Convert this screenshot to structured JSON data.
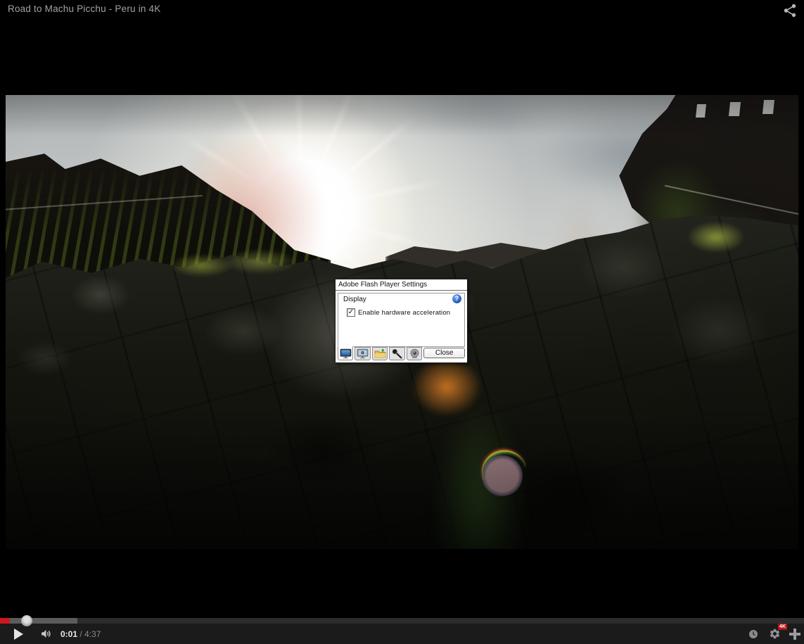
{
  "header": {
    "title": "Road to Machu Picchu - Peru in 4K",
    "share_icon": "share-icon"
  },
  "dialog": {
    "title": "Adobe Flash Player Settings",
    "section_label": "Display",
    "help_glyph": "?",
    "checkbox": {
      "label": "Enable hardware acceleration",
      "checked": true,
      "check_glyph": "✓"
    },
    "tabs": [
      {
        "icon": "display-monitor-icon",
        "selected": true
      },
      {
        "icon": "privacy-monitor-icon",
        "selected": false
      },
      {
        "icon": "local-storage-folder-icon",
        "selected": false
      },
      {
        "icon": "microphone-icon",
        "selected": false
      },
      {
        "icon": "camera-icon",
        "selected": false
      }
    ],
    "close_label": "Close"
  },
  "controls": {
    "play_icon": "play-icon",
    "volume_icon": "volume-icon",
    "current_time": "0:01",
    "time_separator": " / ",
    "duration": "4:37",
    "watch_later_icon": "clock-icon",
    "settings_icon": "gear-icon",
    "quality_badge": "4K",
    "fullscreen_icon": "fullscreen-icon",
    "progress": {
      "played_percent": 1.2,
      "buffered_percent": 9.6,
      "scrubber_left_percent": 2.6
    }
  },
  "colors": {
    "accent_red": "#cc181e",
    "help_blue": "#2a66c9",
    "controlbar_bg": "#1b1b1b"
  }
}
